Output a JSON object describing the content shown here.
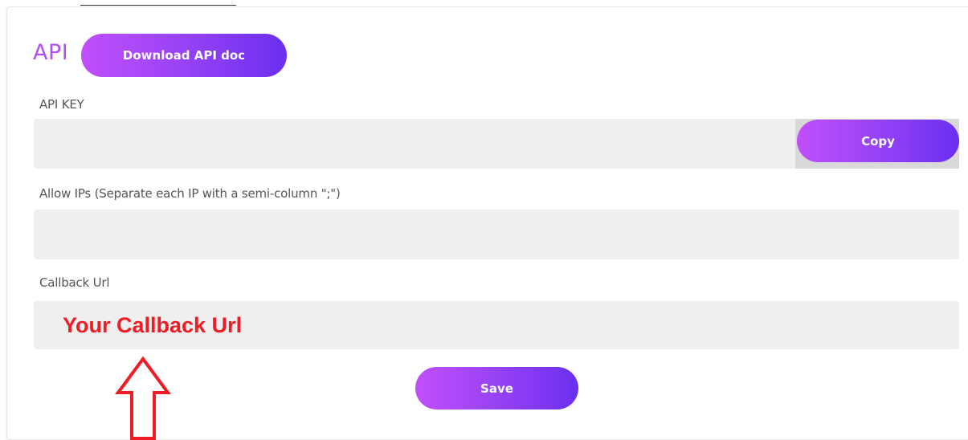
{
  "section": {
    "title": "API",
    "download_label": "Download API doc"
  },
  "api_key": {
    "label": "API KEY",
    "value": "",
    "copy_label": "Copy"
  },
  "allow_ips": {
    "label": "Allow IPs (Separate each IP with a semi-column \";\")",
    "value": ""
  },
  "callback": {
    "label": "Callback Url",
    "value": ""
  },
  "annotation": {
    "text": "Your Callback Url",
    "arrow_icon": "up-arrow-outline-icon",
    "color": "#ee1c24"
  },
  "save_label": "Save",
  "colors": {
    "accent": "#b14ef5",
    "button_gradient_start": "#c14ffb",
    "button_gradient_end": "#6b2ff0",
    "input_bg": "#efefef"
  }
}
